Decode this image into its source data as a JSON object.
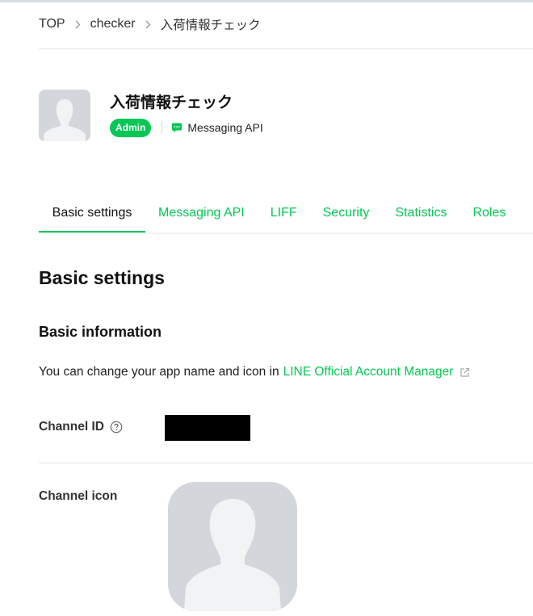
{
  "breadcrumb": {
    "items": [
      "TOP",
      "checker",
      "入荷情報チェック"
    ]
  },
  "channel": {
    "name": "入荷情報チェック",
    "role_badge": "Admin",
    "type_label": "Messaging API"
  },
  "tabs": [
    {
      "label": "Basic settings",
      "active": true
    },
    {
      "label": "Messaging API",
      "active": false
    },
    {
      "label": "LIFF",
      "active": false
    },
    {
      "label": "Security",
      "active": false
    },
    {
      "label": "Statistics",
      "active": false
    },
    {
      "label": "Roles",
      "active": false
    }
  ],
  "content": {
    "page_heading": "Basic settings",
    "section_heading": "Basic information",
    "info_text": "You can change your app name and icon in",
    "info_link": "LINE Official Account Manager",
    "channel_id_label": "Channel ID",
    "channel_icon_label": "Channel icon"
  },
  "icons": {
    "breadcrumb_separator": "chevron-right-icon",
    "messaging": "chat-bubble-icon",
    "external_link": "external-link-icon",
    "help": "question-circle-icon",
    "avatar": "default-avatar-silhouette"
  },
  "colors": {
    "accent": "#06c755",
    "avatar_bg": "#d3d6da",
    "avatar_fg": "#f2f3f5"
  }
}
